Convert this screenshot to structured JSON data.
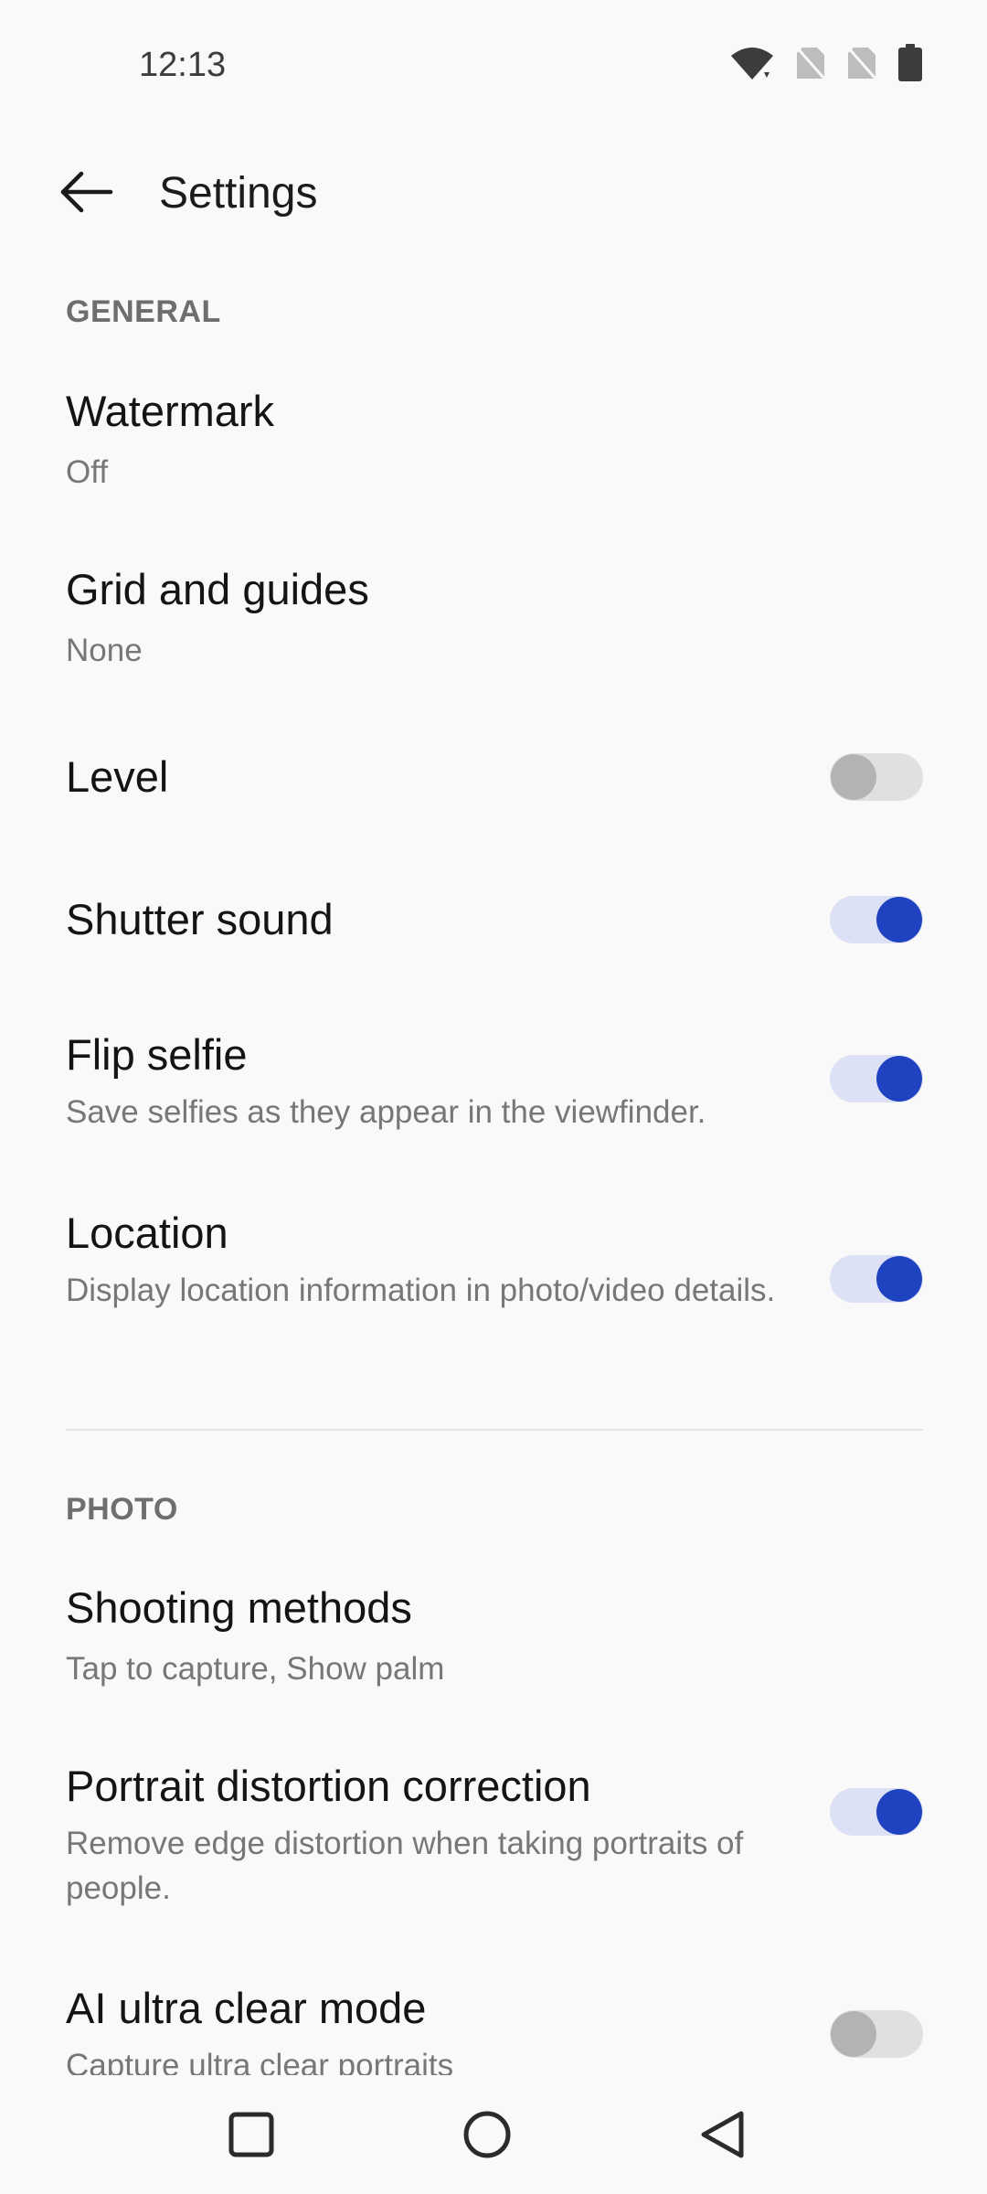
{
  "status_bar": {
    "time": "12:13",
    "icons": [
      "wifi-icon",
      "no-sim-icon",
      "no-sim-icon",
      "battery-icon"
    ]
  },
  "app_bar": {
    "back_icon": "arrow-back-icon",
    "title": "Settings"
  },
  "sections": {
    "general": {
      "header": "GENERAL",
      "watermark": {
        "title": "Watermark",
        "value": "Off"
      },
      "grid": {
        "title": "Grid and guides",
        "value": "None"
      },
      "level": {
        "title": "Level",
        "enabled": false
      },
      "shutter_sound": {
        "title": "Shutter sound",
        "enabled": true
      },
      "flip_selfie": {
        "title": "Flip selfie",
        "subtitle": "Save selfies as they appear in the viewfinder.",
        "enabled": true
      },
      "location": {
        "title": "Location",
        "subtitle": "Display location information in photo/video details.",
        "enabled": true
      }
    },
    "photo": {
      "header": "PHOTO",
      "shooting_methods": {
        "title": "Shooting methods",
        "value": "Tap to capture, Show palm"
      },
      "portrait_correction": {
        "title": "Portrait distortion correction",
        "subtitle": "Remove edge distortion when taking portraits of people.",
        "enabled": true
      },
      "ai_ultra_clear": {
        "title": "AI ultra clear mode",
        "subtitle": "Capture ultra clear portraits",
        "enabled": false
      }
    }
  },
  "colors": {
    "accent": "#1f42c1",
    "accent_track": "#dde1f5",
    "off_thumb": "#b3b3b3",
    "off_track": "#e0e0e0",
    "background": "#f9f9f9"
  },
  "nav_bar": {
    "icons": [
      "recents-square-icon",
      "home-circle-icon",
      "back-triangle-icon"
    ]
  }
}
